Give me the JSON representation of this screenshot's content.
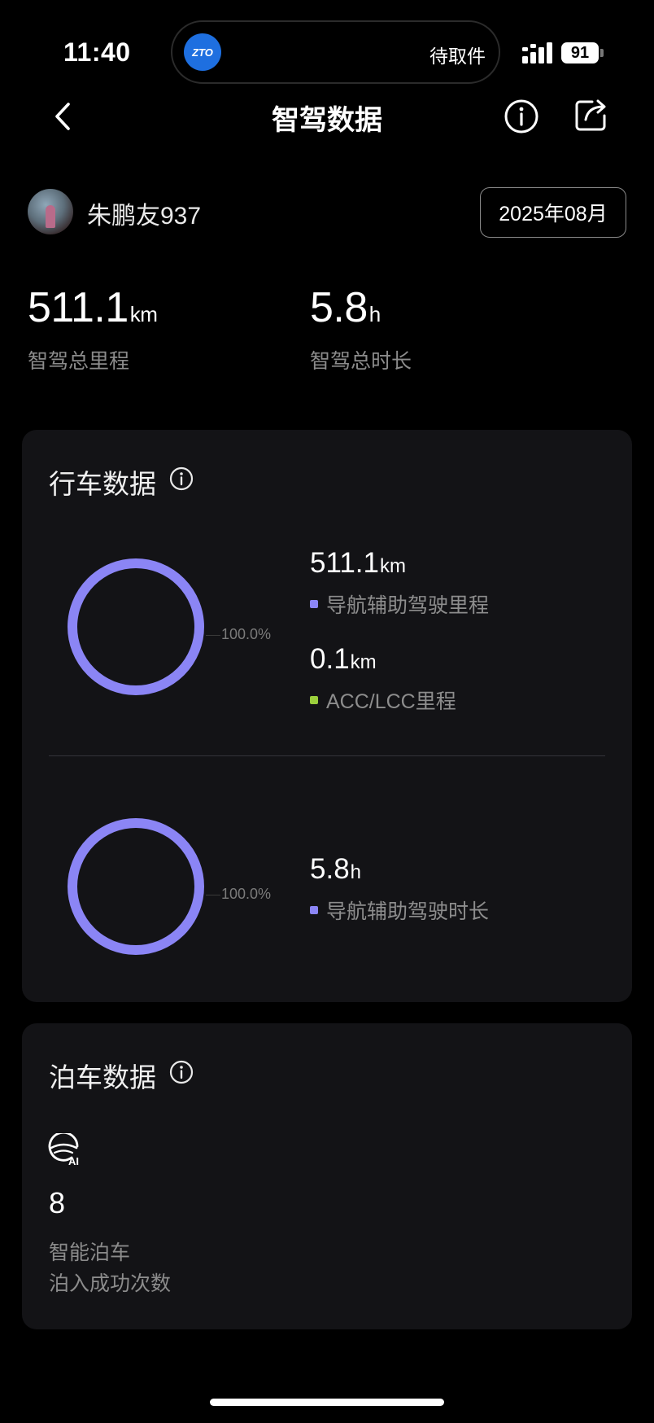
{
  "status_bar": {
    "time": "11:40",
    "island_logo": "ZTO",
    "island_text": "待取件",
    "battery": "91"
  },
  "nav": {
    "title": "智驾数据"
  },
  "user": {
    "name": "朱鹏友937",
    "month": "2025年08月"
  },
  "summary": {
    "mileage_value": "511.1",
    "mileage_unit": "km",
    "mileage_label": "智驾总里程",
    "duration_value": "5.8",
    "duration_unit": "h",
    "duration_label": "智驾总时长"
  },
  "driving": {
    "title": "行车数据",
    "mileage_ring_pct": "100.0%",
    "nav_mileage_value": "511.1",
    "nav_mileage_unit": "km",
    "nav_mileage_label": "导航辅助驾驶里程",
    "acc_mileage_value": "0.1",
    "acc_mileage_unit": "km",
    "acc_mileage_label": "ACC/LCC里程",
    "duration_ring_pct": "100.0%",
    "nav_duration_value": "5.8",
    "nav_duration_unit": "h",
    "nav_duration_label": "导航辅助驾驶时长"
  },
  "parking": {
    "title": "泊车数据",
    "icon_text": "AI",
    "count": "8",
    "label_line1": "智能泊车",
    "label_line2": "泊入成功次数"
  },
  "colors": {
    "nav_assist": "#8b85f5",
    "acc_lcc": "#9bcf3c",
    "card_bg": "#131316"
  },
  "icons": [
    "back-icon",
    "info-icon",
    "share-icon",
    "ai-parking-icon"
  ]
}
